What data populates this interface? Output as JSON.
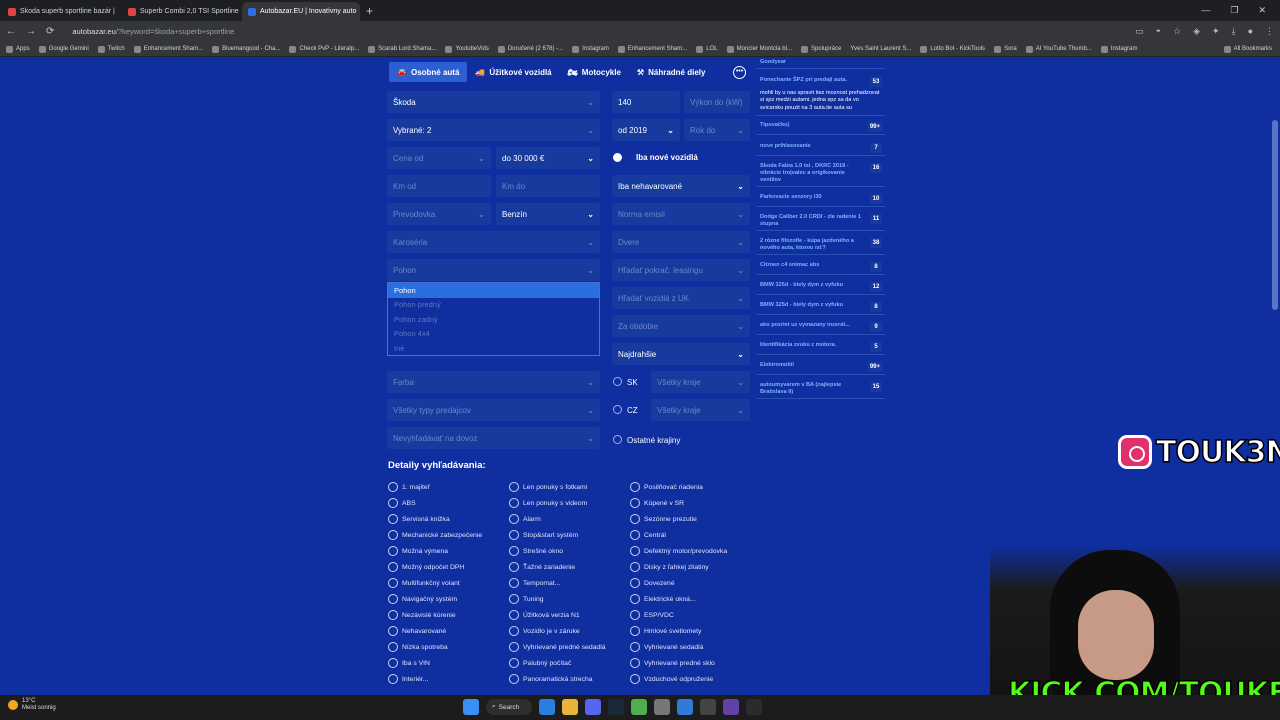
{
  "browser": {
    "tabs": [
      {
        "title": "Skoda superb sportline bazár |"
      },
      {
        "title": "Superb Combi 2,0 TSI Sportline"
      },
      {
        "title": "Autobazar.EU | Inovatívny auto"
      }
    ],
    "url_host": "autobazar.eu",
    "url_path": "/?keyword=škoda+superb+sportline",
    "bookmarks": [
      "Apps",
      "Google Gemini",
      "Twitch",
      "Enhancement Sham...",
      "Bluemangood - Cha...",
      "Check PvP - Literalp...",
      "Scarab Lord Shama...",
      "YoutubeVids",
      "Doručené (2 678) -...",
      "Instagram",
      "Enhancement Sham...",
      "LOL",
      "Moncler Montcla bl...",
      "Spolupráce",
      "Yves Saint Laurent S...",
      "Lotto Bot - KickTools",
      "Sora",
      "AI YouTube Thumb...",
      "Instagram"
    ],
    "all_bookmarks": "All Bookmarks"
  },
  "categories": [
    {
      "label": "Osobné autá",
      "icon": "car-icon"
    },
    {
      "label": "Úžitkové vozidlá",
      "icon": "van-icon"
    },
    {
      "label": "Motocykle",
      "icon": "motorcycle-icon"
    },
    {
      "label": "Náhradné diely",
      "icon": "parts-icon"
    }
  ],
  "filters": {
    "brand": "Škoda",
    "selected": "Vybrané: 2",
    "price_from": "Cena od",
    "price_to": "do 30 000 €",
    "km_from": "Km od",
    "km_to": "Km do",
    "gearbox": "Prevodovka",
    "fuel": "Benzín",
    "body": "Karoséria",
    "drive": "Pohon",
    "power": "140",
    "power_to": "Výkon do (kW)",
    "year_from": "od 2019",
    "year_to": "Rok do",
    "new_only": "Iba nové vozidlá",
    "accident": "Iba nehavarované",
    "emission": "Norma emisií",
    "doors": "Dvere",
    "leasing": "Hľadať pokrač. leasingu",
    "uk": "Hľadať vozidlá z UK",
    "period": "Za obdobie",
    "sort": "Najdrahšie",
    "color": "Farba",
    "sellers": "Všetky typy predajcov",
    "import": "Nevyhľadávať na dovoz",
    "sk": "SK",
    "cz": "CZ",
    "regions_sk": "Všetky kraje",
    "regions_cz": "Všetky kraje",
    "other_countries": "Ostatné krajiny"
  },
  "drive_options": [
    "Pohon",
    "Pohon predný",
    "Pohon zadný",
    "Pohon 4x4",
    "Iné"
  ],
  "details_title": "Detaily vyhľadávania:",
  "details": [
    [
      "1. majiteľ",
      "ABS",
      "Servisná knižka",
      "Mechanické zabezpečenie",
      "Možná výmena",
      "Možný odpočet DPH",
      "Multifunkčný volant",
      "Navigačný systém",
      "Nezávislé kúrenie",
      "Nehavarované",
      "Nízka spotreba",
      "Iba s VIN",
      "Interiér..."
    ],
    [
      "Len ponuky s fotkami",
      "Len ponuky s videom",
      "Alarm",
      "Stop&start systém",
      "Strešné okno",
      "Ťažné zariadenie",
      "Tempomat...",
      "Tuning",
      "Úžitková verzia N1",
      "Vozidlo je v záruke",
      "Vyhrievané predné sedadlá",
      "Palubný počítač",
      "Panoramatická strecha"
    ],
    [
      "Posilňovač riadenia",
      "Kúpené v SR",
      "Sezónne prezutie",
      "Centrál",
      "Defektný motor/prevodovka",
      "Disky z ľahkej zliatiny",
      "Dovezené",
      "Elektrické okná...",
      "ESP/VDC",
      "Hmlové svetlomety",
      "Vyhrievané sedadlá",
      "Vyhrievané predné sklo",
      "Vzduchové odpruženie"
    ]
  ],
  "sidebar": [
    {
      "title": "Goodyear",
      "count": ""
    },
    {
      "title": "Ponechanie ŠPZ pri predaji auta.",
      "count": "53",
      "desc": "mohli by u nas spravit tiez moznost prehadzovat si spz medzi autami. jedna spz sa da vo svicarsku pouzit na 3 auta.tie auta su"
    },
    {
      "title": "Tipovačku)",
      "count": "99+"
    },
    {
      "title": "nove prihlasovanie",
      "count": "7"
    },
    {
      "title": "Skoda Fabia 1.0 tsi , DKRC 2018 - vibrácie trojvalec a origikovanie ventilov",
      "count": "16"
    },
    {
      "title": "Parkovacie senzory i30",
      "count": "10"
    },
    {
      "title": "Dodge Caliber 2.0 CRDI - zle radenie 1 stupna",
      "count": "11"
    },
    {
      "title": "2 rôzne filozofie - kúpa jazdeného a nového auta, ktorou ísť?",
      "count": "38"
    },
    {
      "title": "Citroen c4 snimac abs",
      "count": "8"
    },
    {
      "title": "BMW 325d - biely dym z vyfuku",
      "count": "12"
    },
    {
      "title": "BMW 325d - biely dym z vyfuku",
      "count": "8"
    },
    {
      "title": "ako pozriet uz vymazany inzerát...",
      "count": "9"
    },
    {
      "title": "Identifikácia zvuku z motora.",
      "count": "5"
    },
    {
      "title": "Elektromobil",
      "count": "99+"
    },
    {
      "title": "autoumyvarem v BA (najlepsie Bratislava II)",
      "count": "15"
    }
  ],
  "overlay": {
    "instagram": "TOUK3N",
    "kick": "KICK.COM/TOUKEN"
  },
  "taskbar": {
    "temp": "13°C",
    "weather": "Meist sonnig",
    "search": "Search"
  },
  "colors": {
    "page_bg": "#0f2e9f",
    "accent": "#2d5fd3",
    "link": "#7fb4ff",
    "kick_green": "#53fc18"
  }
}
